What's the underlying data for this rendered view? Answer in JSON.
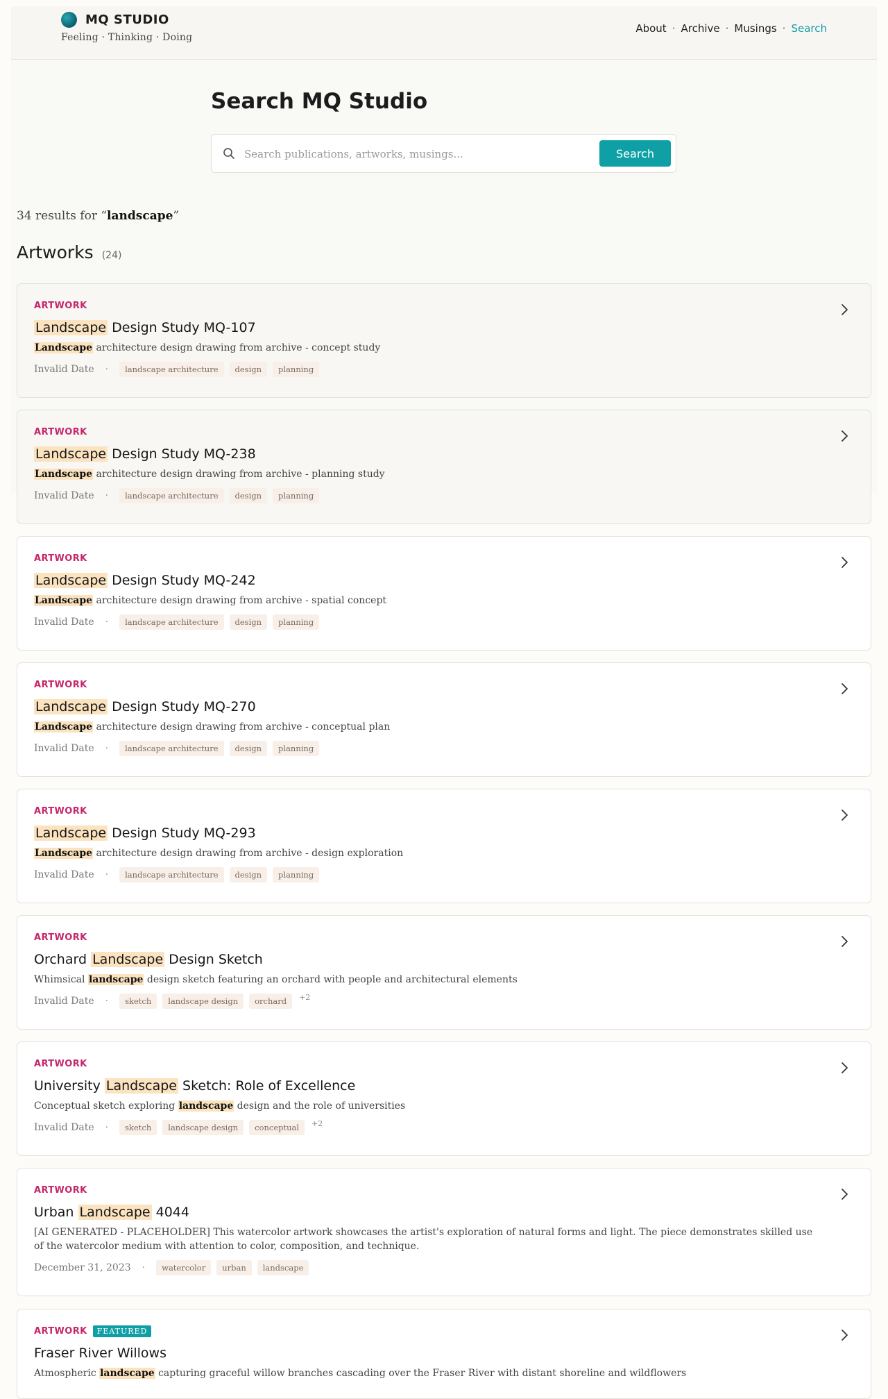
{
  "header": {
    "brand": "MQ STUDIO",
    "tagline": "Feeling · Thinking · Doing",
    "nav": [
      {
        "label": "About"
      },
      {
        "label": "Archive"
      },
      {
        "label": "Musings"
      },
      {
        "label": "Search",
        "active": true
      }
    ],
    "separator": "·"
  },
  "hero": {
    "title": "Search MQ Studio",
    "search_placeholder": "Search publications, artworks, musings...",
    "search_button": "Search"
  },
  "summary": {
    "count_text": "34 results for “",
    "query": "landscape",
    "close_quote": "”"
  },
  "section": {
    "title": "Artworks",
    "count": "(24)"
  },
  "results": [
    {
      "type": "ARTWORK",
      "title": [
        {
          "t": "Landscape",
          "hl": true
        },
        {
          "t": " Design Study MQ-107",
          "hl": false
        }
      ],
      "desc": [
        {
          "t": "Landscape",
          "hl": true
        },
        {
          "t": " architecture design drawing from archive - concept study",
          "hl": false
        }
      ],
      "date": "Invalid Date",
      "tags": [
        "landscape architecture",
        "design",
        "planning"
      ]
    },
    {
      "type": "ARTWORK",
      "title": [
        {
          "t": "Landscape",
          "hl": true
        },
        {
          "t": " Design Study MQ-238",
          "hl": false
        }
      ],
      "desc": [
        {
          "t": "Landscape",
          "hl": true
        },
        {
          "t": " architecture design drawing from archive - planning study",
          "hl": false
        }
      ],
      "date": "Invalid Date",
      "tags": [
        "landscape architecture",
        "design",
        "planning"
      ]
    },
    {
      "type": "ARTWORK",
      "title": [
        {
          "t": "Landscape",
          "hl": true
        },
        {
          "t": " Design Study MQ-242",
          "hl": false
        }
      ],
      "desc": [
        {
          "t": "Landscape",
          "hl": true
        },
        {
          "t": " architecture design drawing from archive - spatial concept",
          "hl": false
        }
      ],
      "date": "Invalid Date",
      "tags": [
        "landscape architecture",
        "design",
        "planning"
      ]
    },
    {
      "type": "ARTWORK",
      "title": [
        {
          "t": "Landscape",
          "hl": true
        },
        {
          "t": " Design Study MQ-270",
          "hl": false
        }
      ],
      "desc": [
        {
          "t": "Landscape",
          "hl": true
        },
        {
          "t": " architecture design drawing from archive - conceptual plan",
          "hl": false
        }
      ],
      "date": "Invalid Date",
      "tags": [
        "landscape architecture",
        "design",
        "planning"
      ]
    },
    {
      "type": "ARTWORK",
      "title": [
        {
          "t": "Landscape",
          "hl": true
        },
        {
          "t": " Design Study MQ-293",
          "hl": false
        }
      ],
      "desc": [
        {
          "t": "Landscape",
          "hl": true
        },
        {
          "t": " architecture design drawing from archive - design exploration",
          "hl": false
        }
      ],
      "date": "Invalid Date",
      "tags": [
        "landscape architecture",
        "design",
        "planning"
      ]
    },
    {
      "type": "ARTWORK",
      "title": [
        {
          "t": "Orchard ",
          "hl": false
        },
        {
          "t": "Landscape",
          "hl": true
        },
        {
          "t": " Design Sketch",
          "hl": false
        }
      ],
      "desc": [
        {
          "t": "Whimsical ",
          "hl": false
        },
        {
          "t": "landscape",
          "hl": true
        },
        {
          "t": " design sketch featuring an orchard with people and architectural elements",
          "hl": false
        }
      ],
      "date": "Invalid Date",
      "tags": [
        "sketch",
        "landscape design",
        "orchard"
      ],
      "more": "+2"
    },
    {
      "type": "ARTWORK",
      "title": [
        {
          "t": "University ",
          "hl": false
        },
        {
          "t": "Landscape",
          "hl": true
        },
        {
          "t": " Sketch: Role of Excellence",
          "hl": false
        }
      ],
      "desc": [
        {
          "t": "Conceptual sketch exploring ",
          "hl": false
        },
        {
          "t": "landscape",
          "hl": true
        },
        {
          "t": " design and the role of universities",
          "hl": false
        }
      ],
      "date": "Invalid Date",
      "tags": [
        "sketch",
        "landscape design",
        "conceptual"
      ],
      "more": "+2"
    },
    {
      "type": "ARTWORK",
      "title": [
        {
          "t": "Urban ",
          "hl": false
        },
        {
          "t": "Landscape",
          "hl": true
        },
        {
          "t": " 4044",
          "hl": false
        }
      ],
      "desc": [
        {
          "t": "[AI GENERATED - PLACEHOLDER] This watercolor artwork showcases the artist's exploration of natural forms and light. The piece demonstrates skilled use of the watercolor medium with attention to color, composition, and technique.",
          "hl": false
        }
      ],
      "date": "December 31, 2023",
      "tags": [
        "watercolor",
        "urban",
        "landscape"
      ]
    },
    {
      "type": "ARTWORK",
      "featured": "FEATURED",
      "title": [
        {
          "t": "Fraser River Willows",
          "hl": false
        }
      ],
      "desc": [
        {
          "t": "Atmospheric ",
          "hl": false
        },
        {
          "t": "landscape",
          "hl": true
        },
        {
          "t": " capturing graceful willow branches cascading over the Fraser River with distant shoreline and wildflowers",
          "hl": false
        }
      ],
      "date": "",
      "tags": []
    }
  ],
  "colors": {
    "accent": "#0fa0a6",
    "type_label": "#c6286c",
    "highlight": "#fbe3c0"
  },
  "icons": {
    "search": "search-icon",
    "chevron": "chevron-right-icon",
    "logo": "logo-circle-icon"
  }
}
